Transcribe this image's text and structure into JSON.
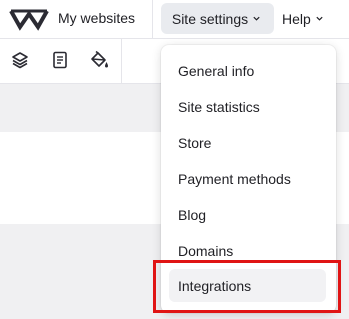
{
  "header": {
    "logo_icon": "webwave-logo-icon",
    "my_websites_label": "My websites",
    "site_settings_label": "Site settings",
    "help_label": "Help"
  },
  "toolbar": {
    "icons": [
      "layers-icon",
      "page-icon",
      "paint-bucket-icon"
    ]
  },
  "dropdown": {
    "items": [
      {
        "label": "General info"
      },
      {
        "label": "Site statistics"
      },
      {
        "label": "Store"
      },
      {
        "label": "Payment methods"
      },
      {
        "label": "Blog"
      },
      {
        "label": "Domains"
      },
      {
        "label": "Integrations",
        "highlighted": true
      }
    ]
  },
  "colors": {
    "highlight_border": "#e01414",
    "active_tab_bg": "#e9ebef",
    "text": "#1f1f24"
  }
}
